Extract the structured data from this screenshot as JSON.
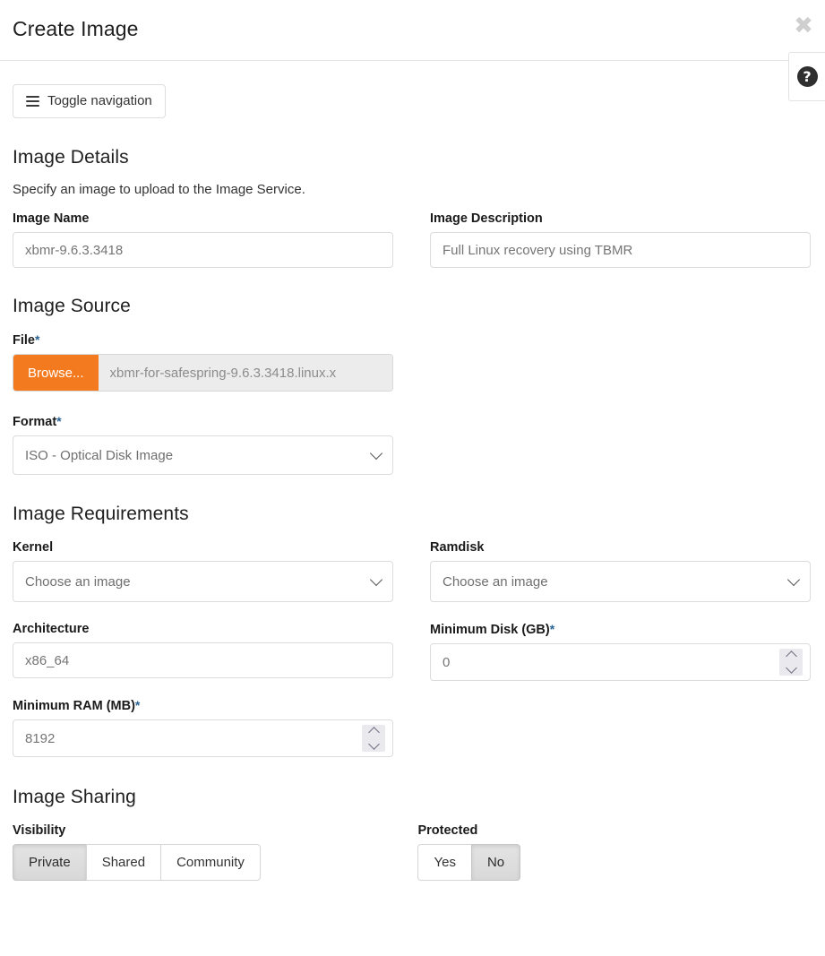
{
  "header": {
    "title": "Create Image",
    "close_icon": "close-icon",
    "help_icon": "question-mark-icon"
  },
  "toolbar": {
    "toggle_nav_label": "Toggle navigation",
    "toggle_nav_icon": "hamburger-icon"
  },
  "sections": {
    "details": {
      "heading": "Image Details",
      "description": "Specify an image to upload to the Image Service.",
      "name_label": "Image Name",
      "name_placeholder": "xbmr-9.6.3.3418",
      "description_label": "Image Description",
      "description_placeholder": "Full Linux recovery using TBMR"
    },
    "source": {
      "heading": "Image Source",
      "file_label": "File",
      "file_required": "*",
      "browse_label": "Browse...",
      "file_name": "xbmr-for-safespring-9.6.3.3418.linux.x",
      "format_label": "Format",
      "format_required": "*",
      "format_value": "ISO - Optical Disk Image"
    },
    "requirements": {
      "heading": "Image Requirements",
      "kernel_label": "Kernel",
      "kernel_value": "Choose an image",
      "ramdisk_label": "Ramdisk",
      "ramdisk_value": "Choose an image",
      "architecture_label": "Architecture",
      "architecture_placeholder": "x86_64",
      "min_disk_label": "Minimum Disk (GB)",
      "min_disk_required": "*",
      "min_disk_value": "0",
      "min_ram_label": "Minimum RAM (MB)",
      "min_ram_required": "*",
      "min_ram_value": "8192"
    },
    "sharing": {
      "heading": "Image Sharing",
      "visibility_label": "Visibility",
      "visibility_options": [
        "Private",
        "Shared",
        "Community"
      ],
      "visibility_selected": "Private",
      "protected_label": "Protected",
      "protected_options": [
        "Yes",
        "No"
      ],
      "protected_selected": "No"
    }
  },
  "colors": {
    "browse_orange": "#f47a20",
    "required_blue": "#2a6496",
    "help_dark": "#2f2f2f"
  }
}
